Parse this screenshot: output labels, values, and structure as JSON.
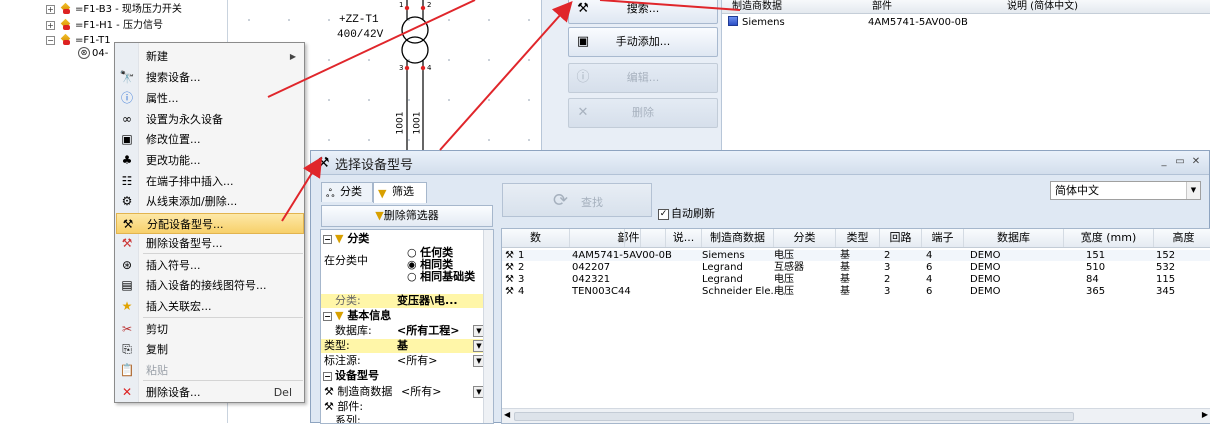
{
  "tree": {
    "items": [
      {
        "label": "=F1-B3 - 现场压力开关",
        "sign": "+"
      },
      {
        "label": "=F1-H1 - 压力信号",
        "sign": "+"
      },
      {
        "label": "=F1-T1",
        "sign": "−"
      }
    ],
    "leaf": "04-"
  },
  "schematic": {
    "device_tag": "+ZZ-T1",
    "voltage": "400/42V",
    "pins": [
      "1",
      "2",
      "3",
      "4"
    ],
    "wire_labels": [
      "1001",
      "1001"
    ]
  },
  "side_buttons": {
    "search": "搜索...",
    "manual_add": "手动添加...",
    "edit": "编辑...",
    "delete": "删除"
  },
  "top_grid": {
    "headers": [
      "制造商数据",
      "部件",
      "说明 (简体中文)"
    ],
    "row": {
      "manufacturer": "Siemens",
      "part": "4AM5741-5AV00-0B"
    }
  },
  "context_menu": {
    "items": [
      {
        "label": "新建",
        "icon": "none",
        "submenu": true
      },
      {
        "label": "搜索设备...",
        "icon": "binoculars-icon"
      },
      {
        "label": "属性...",
        "icon": "info-icon"
      },
      {
        "label": "设置为永久设备",
        "icon": "infinity-icon"
      },
      {
        "label": "修改位置...",
        "icon": "location-icon"
      },
      {
        "label": "更改功能...",
        "icon": "function-icon"
      },
      {
        "label": "在端子排中插入...",
        "icon": "terminal-icon"
      },
      {
        "label": "从线束添加/删除...",
        "icon": "harness-icon"
      },
      {
        "label": "分配设备型号...",
        "icon": "tools-icon",
        "highlighted": true
      },
      {
        "label": "删除设备型号...",
        "icon": "tools-delete-icon"
      },
      {
        "label": "插入符号...",
        "icon": "symbol-icon"
      },
      {
        "label": "插入设备的接线图符号...",
        "icon": "wiring-symbol-icon"
      },
      {
        "label": "插入关联宏...",
        "icon": "star-icon"
      },
      {
        "label": "剪切",
        "icon": "scissors-icon"
      },
      {
        "label": "复制",
        "icon": "copy-icon"
      },
      {
        "label": "粘贴",
        "icon": "paste-icon",
        "disabled": true
      },
      {
        "label": "删除设备...",
        "icon": "delete-x-icon",
        "shortcut": "Del"
      }
    ]
  },
  "dialog": {
    "title": "选择设备型号",
    "tabs": [
      "分类",
      "筛选"
    ],
    "delete_filter": "删除筛选器",
    "refresh_button": "查找",
    "auto_refresh": "自动刷新",
    "language": "简体中文",
    "props": {
      "cat_classify": "分类",
      "in_category": "在分类中",
      "opt_any": "任何类",
      "opt_same": "相同类",
      "opt_base": "相同基础类",
      "classify_key": "分类:",
      "classify_val": "变压器\\电...",
      "cat_basic": "基本信息",
      "db_key": "数据库:",
      "db_val": "<所有工程>",
      "type_key": "类型:",
      "type_val": "基",
      "annot_key": "标注源:",
      "annot_val": "<所有>",
      "cat_devmodel": "设备型号",
      "mfr_key": "制造商数据",
      "mfr_val": "<所有>",
      "part_key": "部件:",
      "series_key": "系列:"
    },
    "grid": {
      "headers": [
        "数",
        "部件",
        "说...",
        "制造商数据",
        "分类",
        "类型",
        "回路",
        "端子",
        "数据库",
        "宽度 (mm)",
        "高度"
      ],
      "rows": [
        [
          "1",
          "4AM5741-5AV00-0B",
          "",
          "Siemens",
          "电压",
          "基",
          "2",
          "4",
          "DEMO",
          "151",
          "152"
        ],
        [
          "2",
          "042207",
          "",
          "Legrand",
          "互感器",
          "基",
          "3",
          "6",
          "DEMO",
          "510",
          "532"
        ],
        [
          "3",
          "042321",
          "",
          "Legrand",
          "电压",
          "基",
          "2",
          "4",
          "DEMO",
          "84",
          "115"
        ],
        [
          "4",
          "TEN003C44",
          "",
          "Schneider Ele...",
          "电压",
          "基",
          "3",
          "6",
          "DEMO",
          "365",
          "345"
        ]
      ]
    }
  },
  "colors": {
    "arrow": "#e0262b",
    "highlight": "#f7d06a",
    "selection": "#fff6a8"
  }
}
